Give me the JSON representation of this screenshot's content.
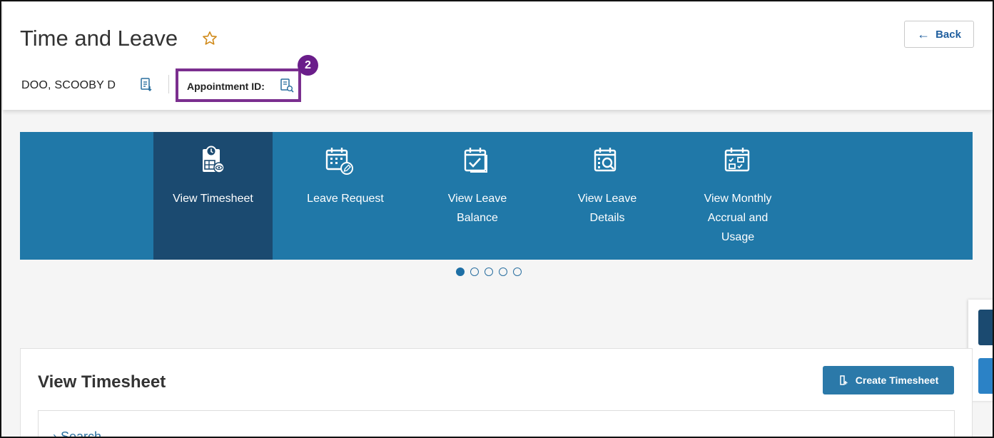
{
  "header": {
    "title": "Time and Leave",
    "back_label": "Back",
    "employee_name": "DOO, SCOOBY D",
    "appointment_label": "Appointment ID:",
    "step_number": "2"
  },
  "carousel": {
    "tiles": [
      {
        "label": "View Timesheet",
        "icon": "timesheet-view-icon",
        "active": true
      },
      {
        "label": "Leave Request",
        "icon": "calendar-edit-icon",
        "active": false
      },
      {
        "label": "View Leave Balance",
        "icon": "calendar-check-icon",
        "active": false
      },
      {
        "label": "View Leave Details",
        "icon": "calendar-search-icon",
        "active": false
      },
      {
        "label": "View Monthly Accrual and Usage",
        "icon": "calendar-grid-check-icon",
        "active": false
      }
    ],
    "page_count": 5,
    "active_page": 1
  },
  "content": {
    "title": "View Timesheet",
    "create_label": "Create Timesheet",
    "search_label": "Search"
  },
  "colors": {
    "carousel_bg": "#2078a8",
    "active_tile": "#1b4a70",
    "highlight_box": "#7b2f8f",
    "star": "#d08a1a"
  }
}
